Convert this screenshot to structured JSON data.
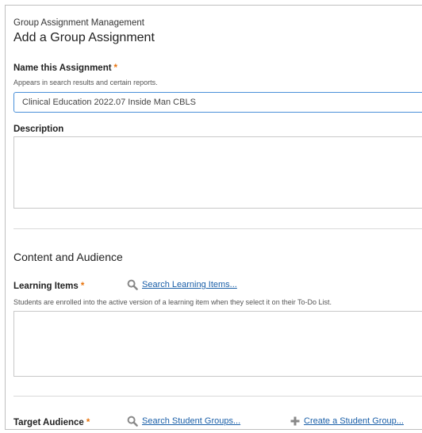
{
  "header": {
    "breadcrumb": "Group Assignment Management",
    "title": "Add a Group Assignment"
  },
  "name_field": {
    "label": "Name this Assignment",
    "required_mark": "*",
    "help": "Appears in search results and certain reports.",
    "value": "Clinical Education 2022.07 Inside Man CBLS"
  },
  "description_field": {
    "label": "Description",
    "value": ""
  },
  "content_section": {
    "title": "Content and Audience"
  },
  "learning_items": {
    "label": "Learning Items",
    "required_mark": "*",
    "search_link": "Search Learning Items...",
    "help": "Students are enrolled into the active version of a learning item when they select it on their To-Do List."
  },
  "target_audience": {
    "label": "Target Audience",
    "required_mark": "*",
    "search_link": "Search Student Groups...",
    "create_link": "Create a Student Group..."
  },
  "icons": {
    "search": "magnifier-icon",
    "create": "plus-icon"
  },
  "colors": {
    "required": "#e8730c",
    "link": "#1a5fa8",
    "focus_border": "#4a90d9"
  }
}
